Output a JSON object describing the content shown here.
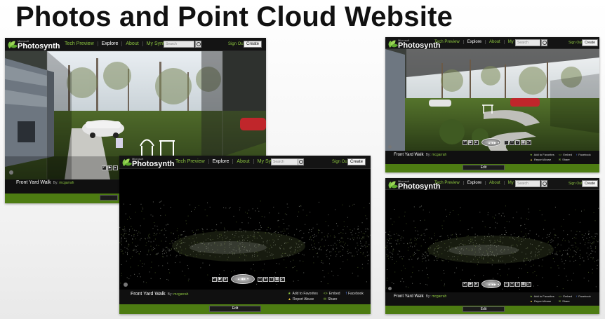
{
  "slide": {
    "title": "Photos and Point Cloud Website"
  },
  "site": {
    "brand_small": "Microsoft",
    "brand": "Photosynth",
    "nav": [
      "Tech Preview",
      "Explore",
      "About",
      "My Synths"
    ],
    "search_placeholder": "Search",
    "sign_out": "Sign Out",
    "create": "Create"
  },
  "synth": {
    "name": "Front Yard Walk",
    "by_label": "By:",
    "author": "mcgarrah"
  },
  "footer_links": {
    "favorites": "Add to Favorites",
    "embed": "Embed",
    "facebook": "Facebook",
    "report": "Report Abuse",
    "share": "Share"
  },
  "edit_label": "Edit",
  "icons": [
    "photosynth-logo-icon",
    "search-icon",
    "rotate-icon",
    "play-icon",
    "next-icon",
    "nav-pad-icon",
    "zoom-out-icon",
    "zoom-in-icon",
    "help-icon",
    "fullscreen-icon",
    "star-icon",
    "warning-icon",
    "embed-icon",
    "facebook-icon",
    "share-icon"
  ],
  "colors": {
    "accent_green": "#8cc63f",
    "footer_green": "#4d7c12",
    "background_dark": "#0d0d0d"
  }
}
